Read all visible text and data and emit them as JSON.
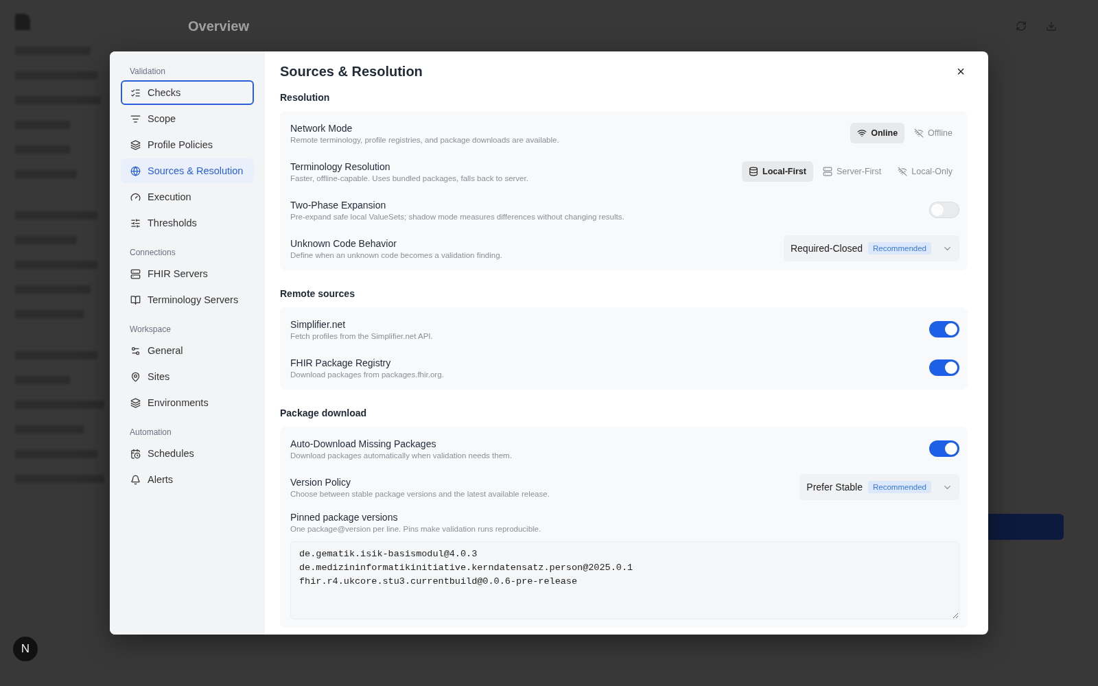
{
  "app": {
    "page_title": "Overview",
    "user_initial": "N"
  },
  "dialog": {
    "title": "Sources & Resolution",
    "close": "×",
    "nav": [
      {
        "heading": "Validation",
        "items": [
          {
            "label": "Checks",
            "selected": false,
            "focused": true
          },
          {
            "label": "Scope",
            "selected": false,
            "focused": false
          },
          {
            "label": "Profile Policies",
            "selected": false,
            "focused": false
          },
          {
            "label": "Sources & Resolution",
            "selected": true,
            "focused": false
          },
          {
            "label": "Execution",
            "selected": false,
            "focused": false
          },
          {
            "label": "Thresholds",
            "selected": false,
            "focused": false
          }
        ]
      },
      {
        "heading": "Connections",
        "items": [
          {
            "label": "FHIR Servers",
            "selected": false,
            "focused": false
          },
          {
            "label": "Terminology Servers",
            "selected": false,
            "focused": false
          }
        ]
      },
      {
        "heading": "Workspace",
        "items": [
          {
            "label": "General",
            "selected": false,
            "focused": false
          },
          {
            "label": "Sites",
            "selected": false,
            "focused": false
          },
          {
            "label": "Environments",
            "selected": false,
            "focused": false
          }
        ]
      },
      {
        "heading": "Automation",
        "items": [
          {
            "label": "Schedules",
            "selected": false,
            "focused": false
          },
          {
            "label": "Alerts",
            "selected": false,
            "focused": false
          }
        ]
      }
    ],
    "sections": [
      {
        "heading": "Resolution",
        "rows": [
          {
            "kind": "segmented",
            "title": "Network Mode",
            "description": "Remote terminology, profile registries, and package downloads are available.",
            "options": [
              {
                "label": "Online",
                "selected": true
              },
              {
                "label": "Offline",
                "selected": false
              }
            ]
          },
          {
            "kind": "segmented",
            "title": "Terminology Resolution",
            "description": "Faster, offline-capable. Uses bundled packages, falls back to server.",
            "options": [
              {
                "label": "Local-First",
                "selected": true
              },
              {
                "label": "Server-First",
                "selected": false
              },
              {
                "label": "Local-Only",
                "selected": false
              }
            ]
          },
          {
            "kind": "toggle",
            "title": "Two-Phase Expansion",
            "description": "Pre-expand safe local ValueSets; shadow mode measures differences without changing results.",
            "on": false,
            "disabled": true
          },
          {
            "kind": "select",
            "title": "Unknown Code Behavior",
            "description": "Define when an unknown code becomes a validation finding.",
            "value": "Required-Closed",
            "badge": "Recommended"
          }
        ]
      },
      {
        "heading": "Remote sources",
        "rows": [
          {
            "kind": "toggle",
            "title": "Simplifier.net",
            "description": "Fetch profiles from the Simplifier.net API.",
            "on": true,
            "disabled": false
          },
          {
            "kind": "toggle",
            "title": "FHIR Package Registry",
            "description": "Download packages from packages.fhir.org.",
            "on": true,
            "disabled": false
          }
        ]
      },
      {
        "heading": "Package download",
        "rows": [
          {
            "kind": "toggle",
            "title": "Auto-Download Missing Packages",
            "description": "Download packages automatically when validation needs them.",
            "on": true,
            "disabled": false
          },
          {
            "kind": "select",
            "title": "Version Policy",
            "description": "Choose between stable package versions and the latest available release.",
            "value": "Prefer Stable",
            "badge": "Recommended"
          },
          {
            "kind": "textarea",
            "title": "Pinned package versions",
            "description": "One package@version per line. Pins make validation runs reproducible.",
            "lines": [
              "de.gematik.isik-basismodul@4.0.3",
              "de.medizininformatikinitiative.kerndatensatz.person@2025.0.1",
              "fhir.r4.ukcore.stu3.currentbuild@0.0.6-pre-release"
            ]
          }
        ]
      }
    ]
  }
}
